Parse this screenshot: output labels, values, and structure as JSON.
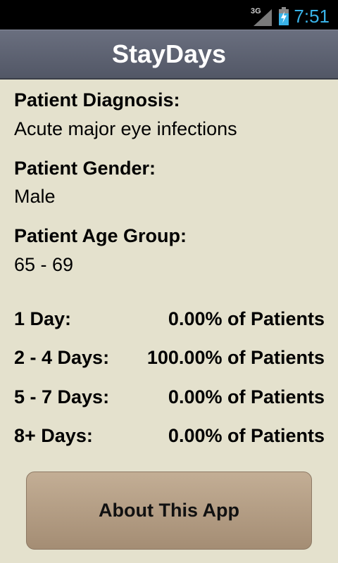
{
  "status_bar": {
    "network": "3G",
    "time": "7:51",
    "colors": {
      "clock": "#39b3e8",
      "battery": "#39b3e8"
    }
  },
  "app": {
    "title": "StayDays"
  },
  "patient": {
    "diagnosis_label": "Patient Diagnosis:",
    "diagnosis_value": "Acute major eye infections",
    "gender_label": "Patient Gender:",
    "gender_value": "Male",
    "age_label": "Patient Age Group:",
    "age_value": "65 - 69"
  },
  "stay_rows": [
    {
      "label": "1 Day:",
      "value": "0.00% of Patients"
    },
    {
      "label": "2 - 4 Days:",
      "value": "100.00% of Patients"
    },
    {
      "label": "5 - 7 Days:",
      "value": "0.00% of Patients"
    },
    {
      "label": "8+ Days:",
      "value": "0.00% of Patients"
    }
  ],
  "buttons": {
    "about_label": "About This App"
  },
  "icons": {
    "signal": "signal-icon",
    "battery": "battery-icon"
  }
}
